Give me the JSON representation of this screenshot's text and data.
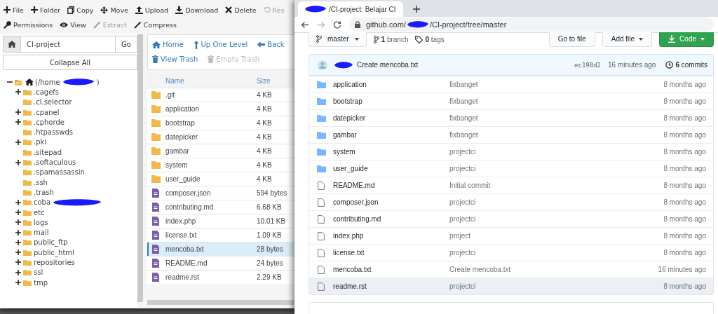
{
  "file_manager": {
    "toolbar": [
      {
        "label": "File",
        "kind": "plus",
        "disabled": false
      },
      {
        "label": "Folder",
        "kind": "plus",
        "disabled": false
      },
      {
        "label": "Copy",
        "kind": "copy",
        "disabled": false
      },
      {
        "label": "Move",
        "kind": "move",
        "disabled": false
      },
      {
        "label": "Upload",
        "kind": "upload",
        "disabled": false
      },
      {
        "label": "Download",
        "kind": "download",
        "disabled": false
      },
      {
        "label": "Delete",
        "kind": "delete",
        "disabled": false
      },
      {
        "label": "Res",
        "kind": "restore",
        "disabled": true
      }
    ],
    "toolbar_2": [
      {
        "label": "Permissions",
        "kind": "key",
        "disabled": false
      },
      {
        "label": "View",
        "kind": "eye",
        "disabled": false
      },
      {
        "label": "Extract",
        "kind": "wand",
        "disabled": true
      },
      {
        "label": "Compress",
        "kind": "wand",
        "disabled": false
      }
    ],
    "path_field": {
      "value": "CI-project"
    },
    "go_button": "Go",
    "collapse_button": "Collapse All",
    "tree": [
      {
        "label": "(/home",
        "label_end": ")",
        "kind": "home",
        "redacted": true,
        "has_children": true,
        "expanded": true,
        "children": [
          {
            "label": ".cagefs",
            "kind": "folder",
            "redacted": false,
            "has_children": true,
            "expanded": false
          },
          {
            "label": ".cl.selector",
            "kind": "folder",
            "redacted": false,
            "has_children": false,
            "expanded": false
          },
          {
            "label": ".cpanel",
            "kind": "folder",
            "redacted": false,
            "has_children": true,
            "expanded": false
          },
          {
            "label": ".cphorde",
            "kind": "folder",
            "redacted": false,
            "has_children": true,
            "expanded": false
          },
          {
            "label": ".htpasswds",
            "kind": "folder",
            "redacted": false,
            "has_children": false,
            "expanded": false
          },
          {
            "label": ".pki",
            "kind": "folder",
            "redacted": false,
            "has_children": true,
            "expanded": false
          },
          {
            "label": ".sitepad",
            "kind": "folder",
            "redacted": false,
            "has_children": false,
            "expanded": false
          },
          {
            "label": ".softaculous",
            "kind": "folder",
            "redacted": false,
            "has_children": true,
            "expanded": false
          },
          {
            "label": ".spamassassin",
            "kind": "folder",
            "redacted": false,
            "has_children": false,
            "expanded": false
          },
          {
            "label": ".ssh",
            "kind": "folder",
            "redacted": false,
            "has_children": false,
            "expanded": false
          },
          {
            "label": ".trash",
            "kind": "folder",
            "redacted": false,
            "has_children": false,
            "expanded": false
          },
          {
            "label": "coba",
            "kind": "folder",
            "redacted": true,
            "has_children": true,
            "expanded": false
          },
          {
            "label": "etc",
            "kind": "folder",
            "redacted": false,
            "has_children": true,
            "expanded": false
          },
          {
            "label": "logs",
            "kind": "folder",
            "redacted": false,
            "has_children": true,
            "expanded": false
          },
          {
            "label": "mail",
            "kind": "folder",
            "redacted": false,
            "has_children": true,
            "expanded": false
          },
          {
            "label": "public_ftp",
            "kind": "folder",
            "redacted": false,
            "has_children": true,
            "expanded": false
          },
          {
            "label": "public_html",
            "kind": "folder",
            "redacted": false,
            "has_children": true,
            "expanded": false
          },
          {
            "label": "repositories",
            "kind": "folder",
            "redacted": false,
            "has_children": true,
            "expanded": false
          },
          {
            "label": "ssl",
            "kind": "folder",
            "redacted": false,
            "has_children": true,
            "expanded": false
          },
          {
            "label": "tmp",
            "kind": "folder",
            "redacted": false,
            "has_children": true,
            "expanded": false
          }
        ]
      }
    ],
    "nav": [
      {
        "label": "Home",
        "kind": "home",
        "disabled": false
      },
      {
        "label": "Up One Level",
        "kind": "up",
        "disabled": false
      },
      {
        "label": "Back",
        "kind": "back",
        "disabled": false
      }
    ],
    "nav_2": [
      {
        "label": "View Trash",
        "kind": "trash",
        "disabled": false
      },
      {
        "label": "Empty Trash",
        "kind": "trash",
        "disabled": true
      }
    ],
    "table": {
      "columns": [
        "Name",
        "Size"
      ],
      "rows": [
        {
          "name": ".git",
          "size": "4 KB",
          "kind": "folder",
          "selected": false
        },
        {
          "name": "application",
          "size": "4 KB",
          "kind": "folder",
          "selected": false
        },
        {
          "name": "bootstrap",
          "size": "4 KB",
          "kind": "folder",
          "selected": false
        },
        {
          "name": "datepicker",
          "size": "4 KB",
          "kind": "folder",
          "selected": false
        },
        {
          "name": "gambar",
          "size": "4 KB",
          "kind": "folder",
          "selected": false
        },
        {
          "name": "system",
          "size": "4 KB",
          "kind": "folder",
          "selected": false
        },
        {
          "name": "user_guide",
          "size": "4 KB",
          "kind": "folder",
          "selected": false
        },
        {
          "name": "composer.json",
          "size": "594 bytes",
          "kind": "file",
          "selected": false
        },
        {
          "name": "contributing.md",
          "size": "6.68 KB",
          "kind": "file",
          "selected": false
        },
        {
          "name": "index.php",
          "size": "10.01 KB",
          "kind": "file",
          "selected": false
        },
        {
          "name": "license.txt",
          "size": "1.09 KB",
          "kind": "file",
          "selected": false
        },
        {
          "name": "mencoba.txt",
          "size": "28 bytes",
          "kind": "file",
          "selected": true
        },
        {
          "name": "README.md",
          "size": "24 bytes",
          "kind": "file",
          "selected": false
        },
        {
          "name": "readme.rst",
          "size": "2.29 KB",
          "kind": "file",
          "selected": false
        }
      ]
    }
  },
  "browser": {
    "tab": {
      "title": "/CI-project: Belajar CI",
      "redacted": true
    },
    "url": {
      "host": "github.com/",
      "path": "/CI-project/tree/master",
      "redacted": true
    },
    "repo": {
      "branch": "master",
      "branches": "**1** branch",
      "tags": "**0** tags",
      "buttons": [
        {
          "label": "Go to file",
          "kind": "plain"
        },
        {
          "label": "Add file",
          "kind": "dropdown"
        },
        {
          "label": "Code",
          "kind": "primary"
        }
      ],
      "commit": {
        "message": "Create mencoba.txt",
        "sha": "ec198d2",
        "time": "16 minutes ago",
        "commits": "**6** commits",
        "redacted": true
      },
      "files": [
        {
          "name": "application",
          "message": "fixbanget",
          "time": "8 months ago",
          "kind": "folder",
          "selected": false
        },
        {
          "name": "bootstrap",
          "message": "fixbanget",
          "time": "8 months ago",
          "kind": "folder",
          "selected": false
        },
        {
          "name": "datepicker",
          "message": "fixbanget",
          "time": "8 months ago",
          "kind": "folder",
          "selected": false
        },
        {
          "name": "gambar",
          "message": "fixbanget",
          "time": "8 months ago",
          "kind": "folder",
          "selected": false
        },
        {
          "name": "system",
          "message": "projectci",
          "time": "8 months ago",
          "kind": "folder",
          "selected": false
        },
        {
          "name": "user_guide",
          "message": "projectci",
          "time": "8 months ago",
          "kind": "folder",
          "selected": false
        },
        {
          "name": "README.md",
          "message": "Initial commit",
          "time": "8 months ago",
          "kind": "file",
          "selected": false
        },
        {
          "name": "composer.json",
          "message": "projectci",
          "time": "8 months ago",
          "kind": "file",
          "selected": false
        },
        {
          "name": "contributing.md",
          "message": "projectci",
          "time": "8 months ago",
          "kind": "file",
          "selected": false
        },
        {
          "name": "index.php",
          "message": "project",
          "time": "8 months ago",
          "kind": "file",
          "selected": false
        },
        {
          "name": "license.txt",
          "message": "projectci",
          "time": "8 months ago",
          "kind": "file",
          "selected": false
        },
        {
          "name": "mencoba.txt",
          "message": "Create mencoba.txt",
          "time": "16 minutes ago",
          "kind": "file",
          "selected": false
        },
        {
          "name": "readme.rst",
          "message": "projectci",
          "time": "8 months ago",
          "kind": "file",
          "selected": true
        }
      ]
    }
  }
}
